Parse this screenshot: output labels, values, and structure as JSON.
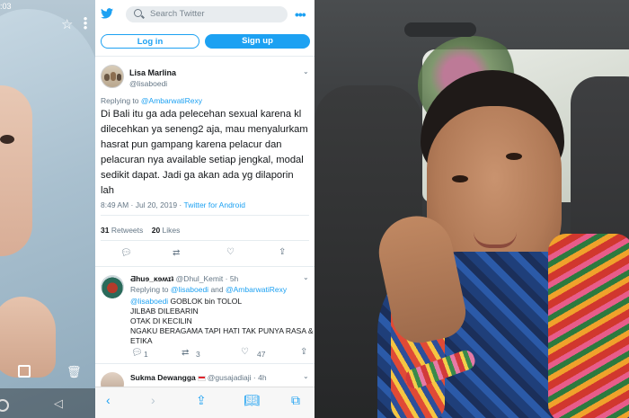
{
  "left_photo": {
    "status_time": ":03",
    "icons": [
      "star-icon",
      "more-vertical-icon",
      "qr-scan-icon",
      "trash-icon",
      "back-arrow-icon",
      "home-circle-icon"
    ]
  },
  "twitter": {
    "search": {
      "placeholder": "Search Twitter"
    },
    "buttons": {
      "login": "Log in",
      "signup": "Sign up"
    },
    "colors": {
      "accent": "#1da1f2",
      "text": "#14171a",
      "muted": "#657786"
    },
    "main_tweet": {
      "name": "Lisa Marlina",
      "handle": "@lisaboedi",
      "replying_prefix": "Replying to ",
      "replying_to": "@AmbarwatiRexy",
      "text": "Di Bali itu ga ada pelecehan sexual karena kl dilecehkan ya seneng2 aja,  mau menyalurkam hasrat pun gampang karena pelacur dan pelacuran nya available setiap jengkal, modal sedikit dapat.  Jadi ga akan ada yg dilaporin lah",
      "timestamp": "8:49 AM · Jul 20, 2019 · ",
      "source": "Twitter for Android",
      "retweets_count": "31",
      "retweets_label": " Retweets",
      "likes_count": "20",
      "likes_label": " Likes"
    },
    "reply1": {
      "name": "Ƌhuɘ_ĸɘʍɪʇ",
      "handle": "@Dhul_Kemit",
      "age": "· 5h",
      "replying_prefix": "Replying to ",
      "replying_to_1": "@lisaboedi",
      "replying_and": " and ",
      "replying_to_2": "@AmbarwatiRexy",
      "mention": "@lisaboedi",
      "lines": [
        " GOBLOK bin TOLOL",
        "JILBAB DILEBARIN",
        "OTAK DI KECILIN",
        "NGAKU BERAGAMA TAPI HATI TAK PUNYA RASA &",
        "ETIKA"
      ],
      "reply_count": "1",
      "retweet_count": "3",
      "like_count": "47"
    },
    "reply2": {
      "name": "Sukma Dewangga",
      "handle": "@gusajadiaji",
      "age": "· 4h"
    },
    "toolbar_icons": [
      "back-icon",
      "forward-icon",
      "share-icon",
      "bookmarks-icon",
      "tabs-icon"
    ]
  }
}
